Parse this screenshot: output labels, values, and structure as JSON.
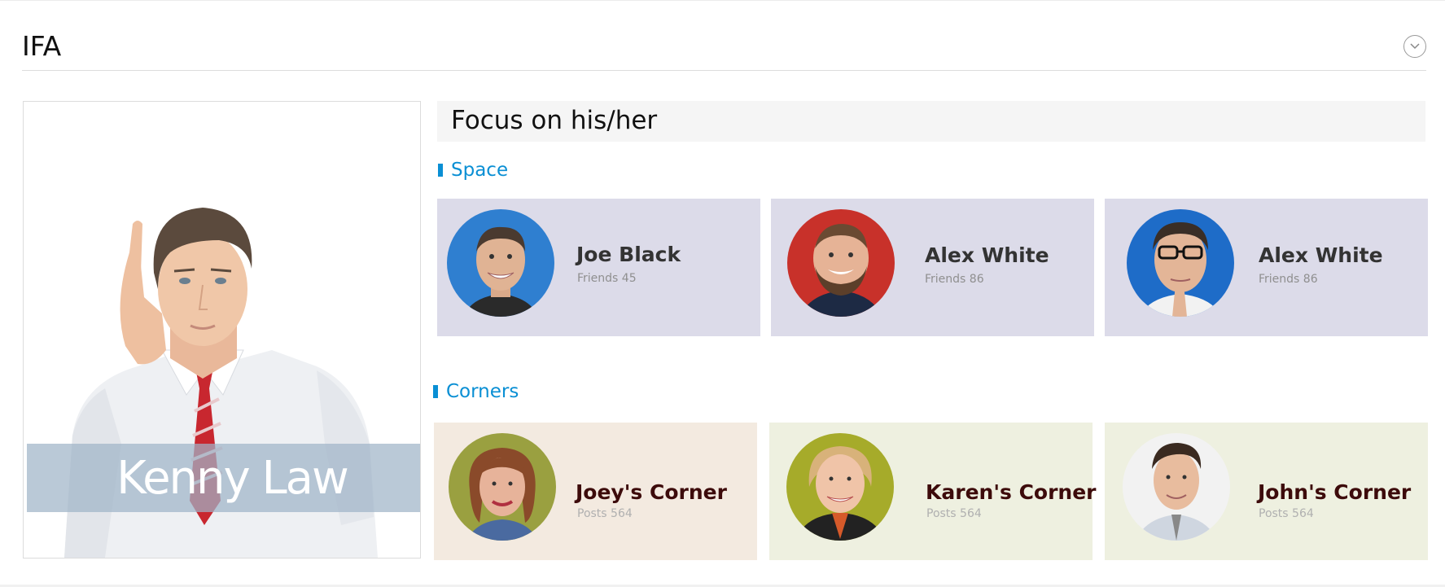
{
  "header": {
    "title": "IFA",
    "collapse_icon": "chevron-down-icon"
  },
  "profile": {
    "name": "Kenny Law",
    "band_color": "#a0b4c8"
  },
  "focus": {
    "title": "Focus on his/her"
  },
  "accent_color": "#0a8fd4",
  "space": {
    "title": "Space",
    "cards": [
      {
        "name": "Joe Black",
        "sub": "Friends 45"
      },
      {
        "name": "Alex White",
        "sub": "Friends 86"
      },
      {
        "name": "Alex White",
        "sub": "Friends 86"
      }
    ]
  },
  "corners": {
    "title": "Corners",
    "cards": [
      {
        "name": "Joey's Corner",
        "sub": "Posts 564"
      },
      {
        "name": "Karen's Corner",
        "sub": "Posts 564"
      },
      {
        "name": "John's Corner",
        "sub": "Posts 564"
      }
    ]
  }
}
